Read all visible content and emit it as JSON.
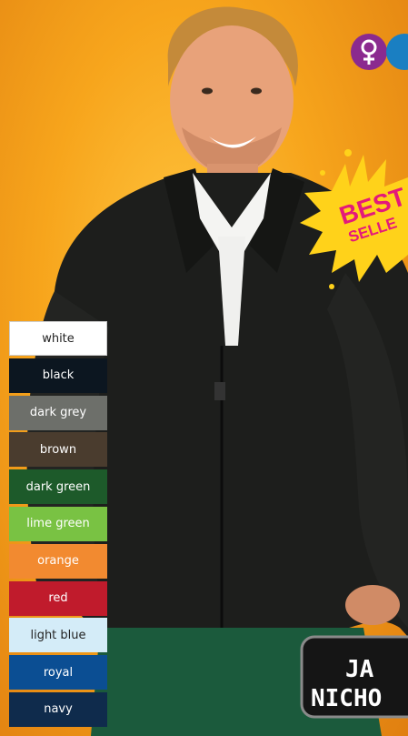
{
  "swatches": [
    {
      "label": "white",
      "bg": "#ffffff",
      "fg": "#222222"
    },
    {
      "label": "black",
      "bg": "#0c1620",
      "fg": "#ffffff"
    },
    {
      "label": "dark grey",
      "bg": "#6d6f6a",
      "fg": "#ffffff"
    },
    {
      "label": "brown",
      "bg": "#4a3c2e",
      "fg": "#ffffff"
    },
    {
      "label": "dark green",
      "bg": "#1d5a2a",
      "fg": "#ffffff"
    },
    {
      "label": "lime green",
      "bg": "#79c243",
      "fg": "#ffffff"
    },
    {
      "label": "orange",
      "bg": "#f28a30",
      "fg": "#ffffff"
    },
    {
      "label": "red",
      "bg": "#c01b2c",
      "fg": "#ffffff"
    },
    {
      "label": "light blue",
      "bg": "#d4ecf8",
      "fg": "#222222"
    },
    {
      "label": "royal",
      "bg": "#0b4e93",
      "fg": "#ffffff"
    },
    {
      "label": "navy",
      "bg": "#0f2b4c",
      "fg": "#ffffff"
    }
  ],
  "badge": {
    "line1": "BEST",
    "line2": "SELLE"
  },
  "logo": {
    "line1": "JA",
    "line2": "NICHO"
  },
  "icons": {
    "gender_female": "female-symbol-icon",
    "gender_male": "male-symbol-icon"
  },
  "colors": {
    "background": "#f7a51c",
    "badge": "#ffd21a",
    "badge_text": "#e4197a",
    "gender_badge": "#8b2a8f"
  }
}
